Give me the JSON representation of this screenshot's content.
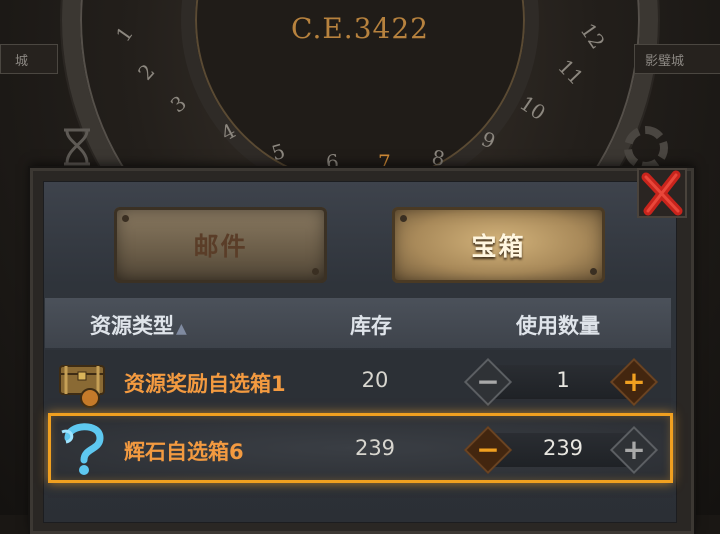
{
  "background": {
    "era_label": "C.E.3422",
    "left_label": "城",
    "right_label": "影璧城",
    "wheel_numbers": [
      "1",
      "2",
      "3",
      "4",
      "5",
      "6",
      "7",
      "8",
      "9",
      "10",
      "11",
      "12"
    ]
  },
  "tabs": {
    "mail_label": "邮件",
    "chest_label": "宝箱",
    "active": "chest"
  },
  "table": {
    "headers": {
      "type": "资源类型",
      "stock": "库存",
      "use_qty": "使用数量"
    },
    "rows": [
      {
        "icon": "treasure-chest-icon",
        "name": "资源奖励自选箱1",
        "stock": "20",
        "qty": "1",
        "selected": false
      },
      {
        "icon": "blue-question-swirl-icon",
        "name": "辉石自选箱6",
        "stock": "239",
        "qty": "239",
        "selected": true
      }
    ]
  },
  "colors": {
    "accent_orange": "#f0a020",
    "item_name": "#f39a40",
    "era_gold": "#b7823e"
  }
}
